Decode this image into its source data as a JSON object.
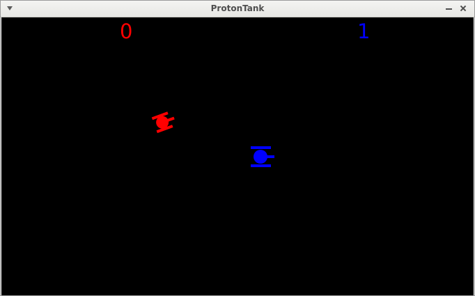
{
  "window": {
    "title": "ProtonTank"
  },
  "scores": {
    "red": "0",
    "blue": "1"
  },
  "colors": {
    "red_player": "#ff0000",
    "blue_player": "#0000ff",
    "arena_background": "#000000"
  },
  "icons": {
    "window_menu": "chevron-down-icon",
    "minimize": "minimize-icon",
    "close": "close-icon"
  }
}
